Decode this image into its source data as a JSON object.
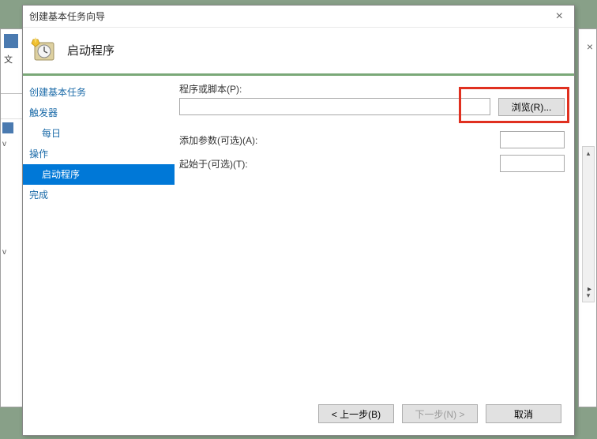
{
  "background": {
    "left_text": "文",
    "close_glyph": "×",
    "scroll_up": "▴",
    "scroll_down": "▾",
    "right_arrow": "▸"
  },
  "dialog": {
    "title": "创建基本任务向导",
    "close_glyph": "×",
    "header_title": "启动程序"
  },
  "nav": {
    "create_task": "创建基本任务",
    "trigger": "触发器",
    "daily": "每日",
    "action": "操作",
    "start_program": "启动程序",
    "finish": "完成"
  },
  "fields": {
    "script_label": "程序或脚本(P):",
    "script_value": "",
    "browse": "浏览(R)...",
    "args_label": "添加参数(可选)(A):",
    "args_value": "",
    "startin_label": "起始于(可选)(T):",
    "startin_value": ""
  },
  "footer": {
    "back": "< 上一步(B)",
    "next": "下一步(N) >",
    "cancel": "取消"
  }
}
